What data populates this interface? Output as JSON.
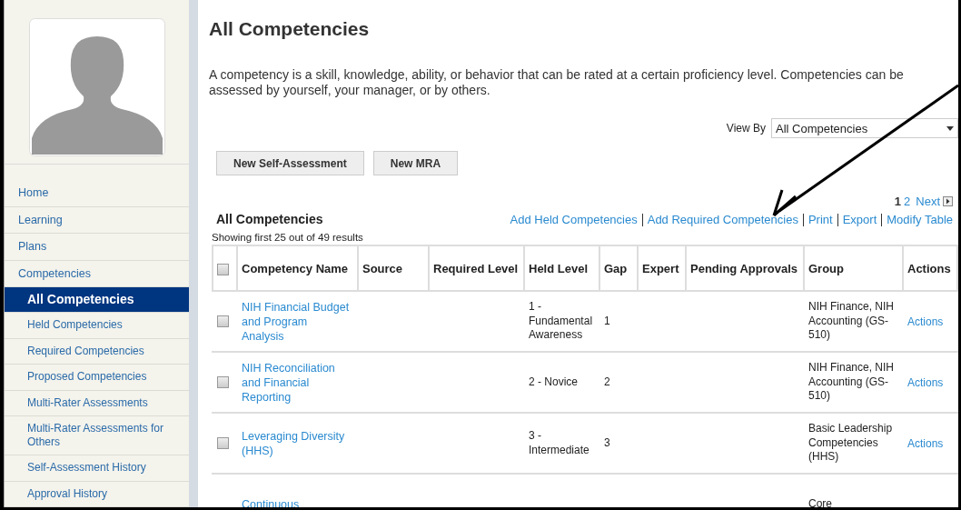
{
  "sidebar": {
    "items": [
      {
        "label": "Home",
        "selected": false
      },
      {
        "label": "Learning",
        "selected": false
      },
      {
        "label": "Plans",
        "selected": false
      },
      {
        "label": "Competencies",
        "selected": false,
        "children": [
          {
            "label": "All Competencies",
            "selected": true
          },
          {
            "label": "Held Competencies",
            "selected": false
          },
          {
            "label": "Required Competencies",
            "selected": false
          },
          {
            "label": "Proposed Competencies",
            "selected": false
          },
          {
            "label": "Multi-Rater Assessments",
            "selected": false
          },
          {
            "label": "Multi-Rater Assessments for Others",
            "selected": false
          },
          {
            "label": "Self-Assessment History",
            "selected": false
          },
          {
            "label": "Approval History",
            "selected": false
          }
        ]
      }
    ]
  },
  "page": {
    "title": "All Competencies",
    "description": "A competency is a skill, knowledge, ability, or behavior that can be rated at a certain proficiency level. Competencies can be assessed by yourself, your manager, or by others.",
    "view_by": {
      "label": "View By",
      "value": "All Competencies"
    },
    "buttons": [
      "New Self-Assessment",
      "New MRA"
    ],
    "pagination": {
      "pages": [
        {
          "label": "1",
          "selected": true
        },
        {
          "label": "2",
          "selected": false
        }
      ],
      "next": "Next"
    },
    "section_title": "All Competencies",
    "links": [
      "Add Held Competencies",
      "Add Required Competencies",
      "Print",
      "Export",
      "Modify Table"
    ],
    "results": "Showing first 25 out of 49 results"
  },
  "table": {
    "select_all_checked": false,
    "columns": [
      "Competency Name",
      "Source",
      "Required Level",
      "Held Level",
      "Gap",
      "Expert",
      "Pending Approvals",
      "Group",
      "Actions"
    ],
    "rows": [
      {
        "checked": false,
        "name": "NIH Financial Budget and Program Analysis",
        "held_level": "1 - Fundamental Awareness",
        "gap": "1",
        "group": "NIH Finance, NIH Accounting (GS-510)",
        "action": "Actions"
      },
      {
        "checked": false,
        "name": "NIH Reconciliation and Financial Reporting",
        "held_level": "2 - Novice",
        "gap": "2",
        "group": "NIH Finance, NIH Accounting (GS-510)",
        "action": "Actions"
      },
      {
        "checked": false,
        "name": "Leveraging Diversity (HHS)",
        "held_level": "3 - Intermediate",
        "gap": "3",
        "group": "Basic Leadership Competencies (HHS)",
        "action": "Actions"
      },
      {
        "name": "Continuous",
        "group": "Core"
      }
    ]
  }
}
